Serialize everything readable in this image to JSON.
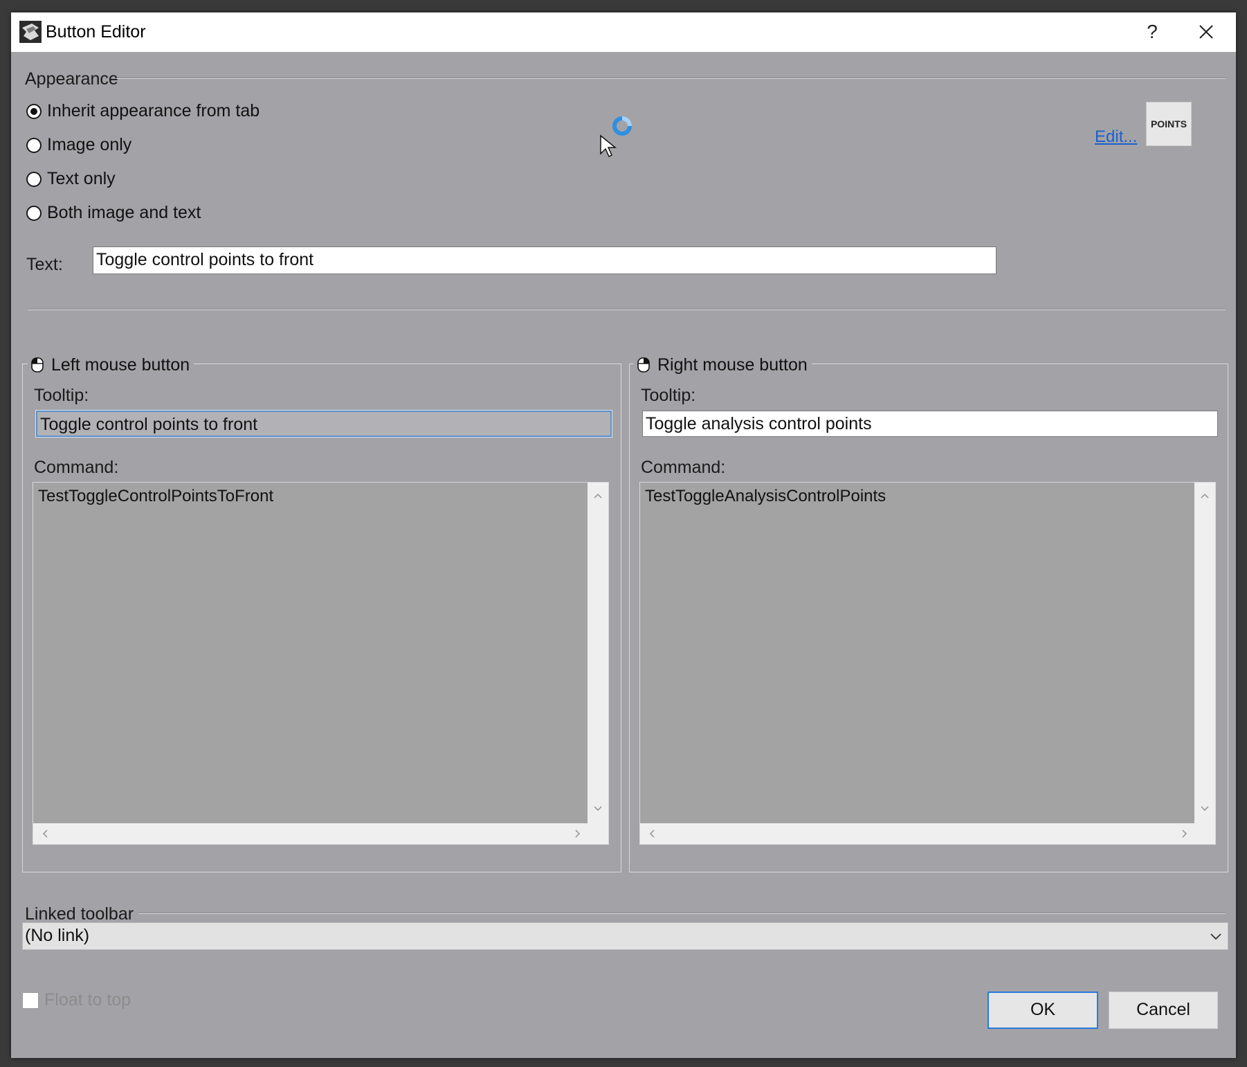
{
  "window": {
    "title": "Button Editor",
    "help_label": "?"
  },
  "appearance": {
    "section_label": "Appearance",
    "options": [
      {
        "label": "Inherit appearance from tab",
        "selected": true
      },
      {
        "label": "Image only",
        "selected": false
      },
      {
        "label": "Text only",
        "selected": false
      },
      {
        "label": "Both image and text",
        "selected": false
      }
    ],
    "edit_link": "Edit...",
    "preview_text": "POINTS",
    "text_label": "Text:",
    "text_value": "Toggle control points to front"
  },
  "left_mouse": {
    "title": "Left mouse button",
    "tooltip_label": "Tooltip:",
    "tooltip_value": "Toggle control points to front",
    "command_label": "Command:",
    "command_value": "TestToggleControlPointsToFront"
  },
  "right_mouse": {
    "title": "Right mouse button",
    "tooltip_label": "Tooltip:",
    "tooltip_value": "Toggle analysis control points",
    "command_label": "Command:",
    "command_value": "TestToggleAnalysisControlPoints"
  },
  "linked_toolbar": {
    "section_label": "Linked toolbar",
    "selected": "(No link)"
  },
  "footer": {
    "float_label": "Float to top",
    "ok_label": "OK",
    "cancel_label": "Cancel"
  },
  "colors": {
    "dialog_bg": "#a3a3a7",
    "accent": "#2a7bd8",
    "link": "#1a5fcf",
    "busy_cursor": "#2f8fe0"
  }
}
